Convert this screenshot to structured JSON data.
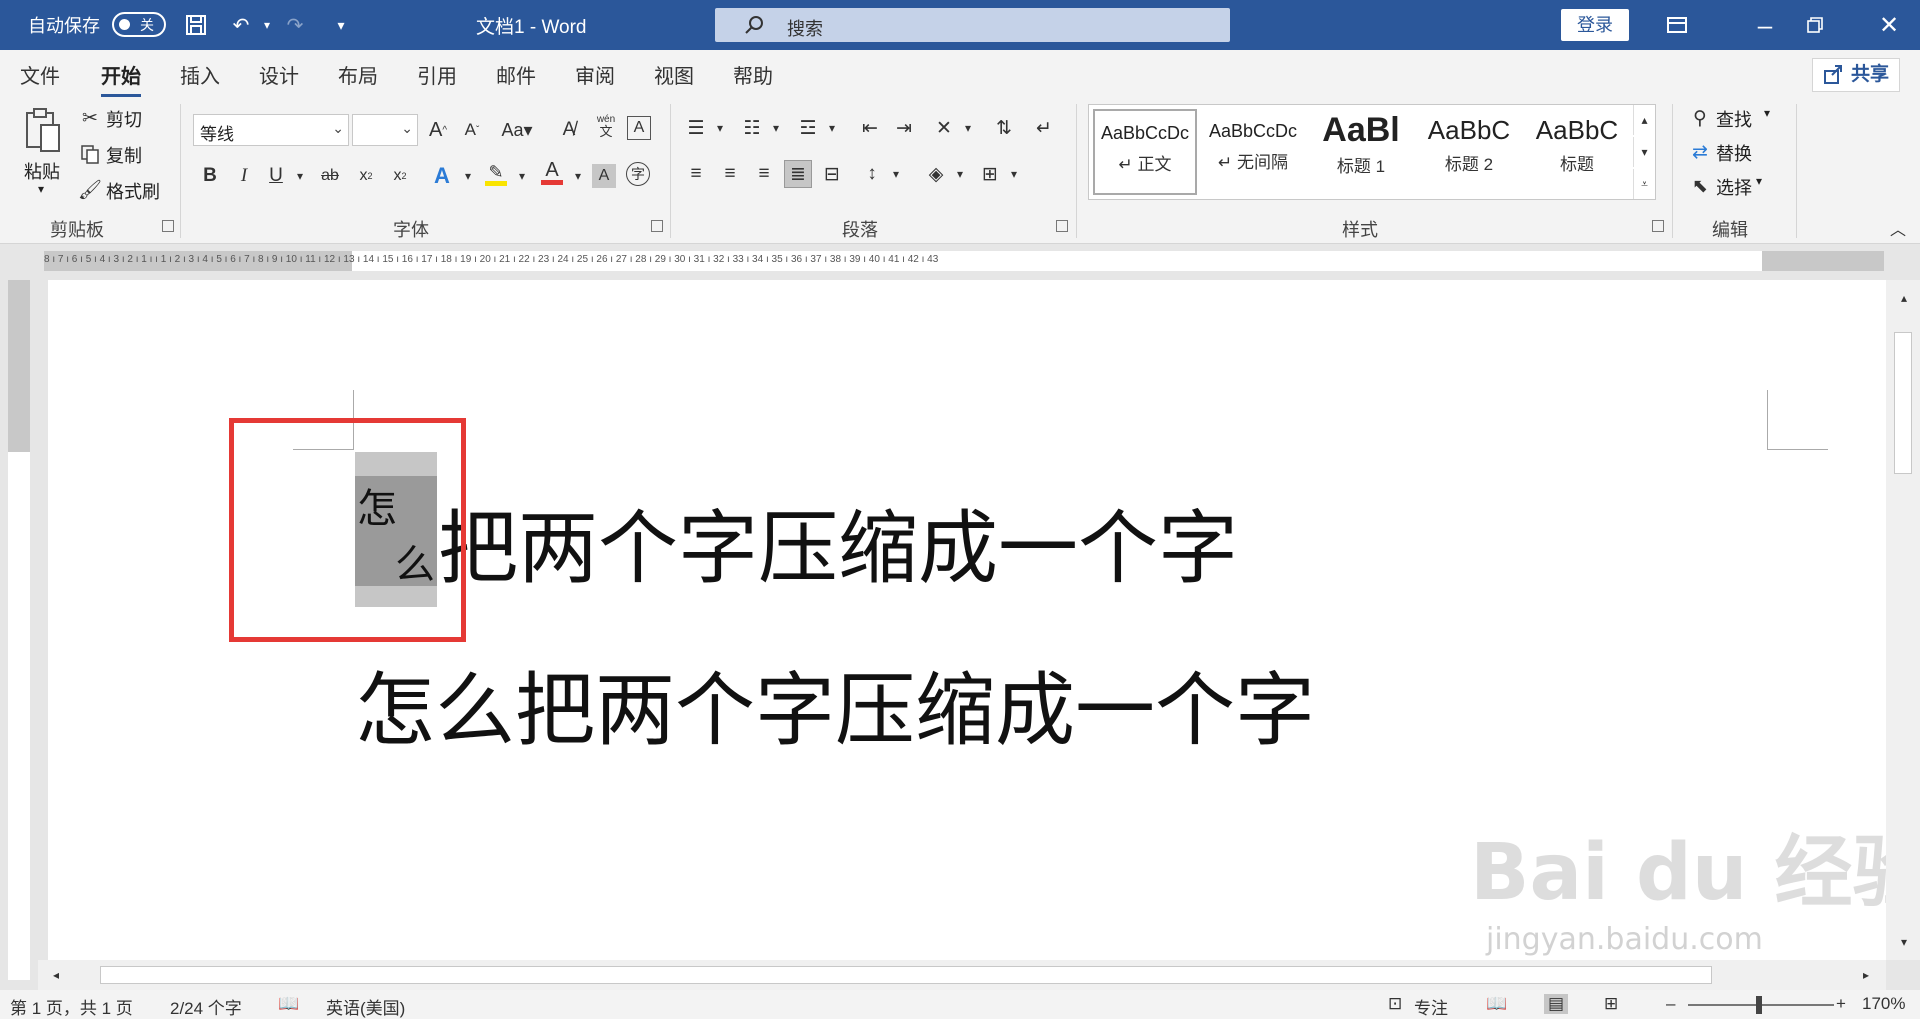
{
  "titlebar": {
    "autosave_label": "自动保存",
    "autosave_state": "关",
    "doc_title": "文档1  -  Word",
    "search_placeholder": "搜索",
    "login_label": "登录"
  },
  "menu": [
    "文件",
    "开始",
    "插入",
    "设计",
    "布局",
    "引用",
    "邮件",
    "审阅",
    "视图",
    "帮助"
  ],
  "menu_active": "开始",
  "share_label": "共享",
  "clipboard": {
    "paste": "粘贴",
    "cut": "剪切",
    "copy": "复制",
    "format_painter": "格式刷",
    "group": "剪贴板"
  },
  "font": {
    "name": "等线",
    "size": "",
    "group": "字体",
    "case_label": "Aa",
    "phonetic_top": "wén",
    "phonetic_bottom": "文",
    "enclose_label": "字",
    "font_color": "#e53935",
    "highlight_color": "#f9e400"
  },
  "paragraph": {
    "group": "段落"
  },
  "styles": {
    "group": "样式",
    "items": [
      {
        "sample": "AaBbCcDc",
        "name": "↵ 正文"
      },
      {
        "sample": "AaBbCcDc",
        "name": "↵ 无间隔"
      },
      {
        "sample": "AaBl",
        "name": "标题 1"
      },
      {
        "sample": "AaBbC",
        "name": "标题 2"
      },
      {
        "sample": "AaBbC",
        "name": "标题"
      }
    ]
  },
  "editing": {
    "find": "查找",
    "replace": "替换",
    "select": "选择",
    "group": "编辑"
  },
  "ruler_ticks": "8  ı  7  ı  6  ı  5  ı  4  ı  3  ı  2  ı  1  ı       ı  1  ı  2  ı  3  ı  4  ı  5  ı  6  ı  7  ı  8  ı  9  ı 10 ı 11 ı 12 ı 13 ı 14 ı 15 ı 16 ı 17 ı 18 ı 19 ı 20 ı 21 ı 22 ı 23 ı 24 ı 25 ı 26 ı 27 ı 28 ı 29 ı 30 ı 31 ı 32 ı 33 ı 34 ı 35 ı 36 ı 37 ı 38 ı 39 ı 40 ı 41 ı 42 ı 43",
  "document": {
    "combined_char_1": "怎",
    "combined_char_2": "么",
    "line1_rest": "把两个字压缩成一个字",
    "line2": "怎么把两个字压缩成一个字"
  },
  "status": {
    "page": "第 1 页，共 1 页",
    "words": "2/24 个字",
    "language": "英语(美国)",
    "focus": "专注",
    "zoom": "170%"
  },
  "watermark": {
    "logo": "Bai du 经验",
    "url": "jingyan.baidu.com"
  }
}
